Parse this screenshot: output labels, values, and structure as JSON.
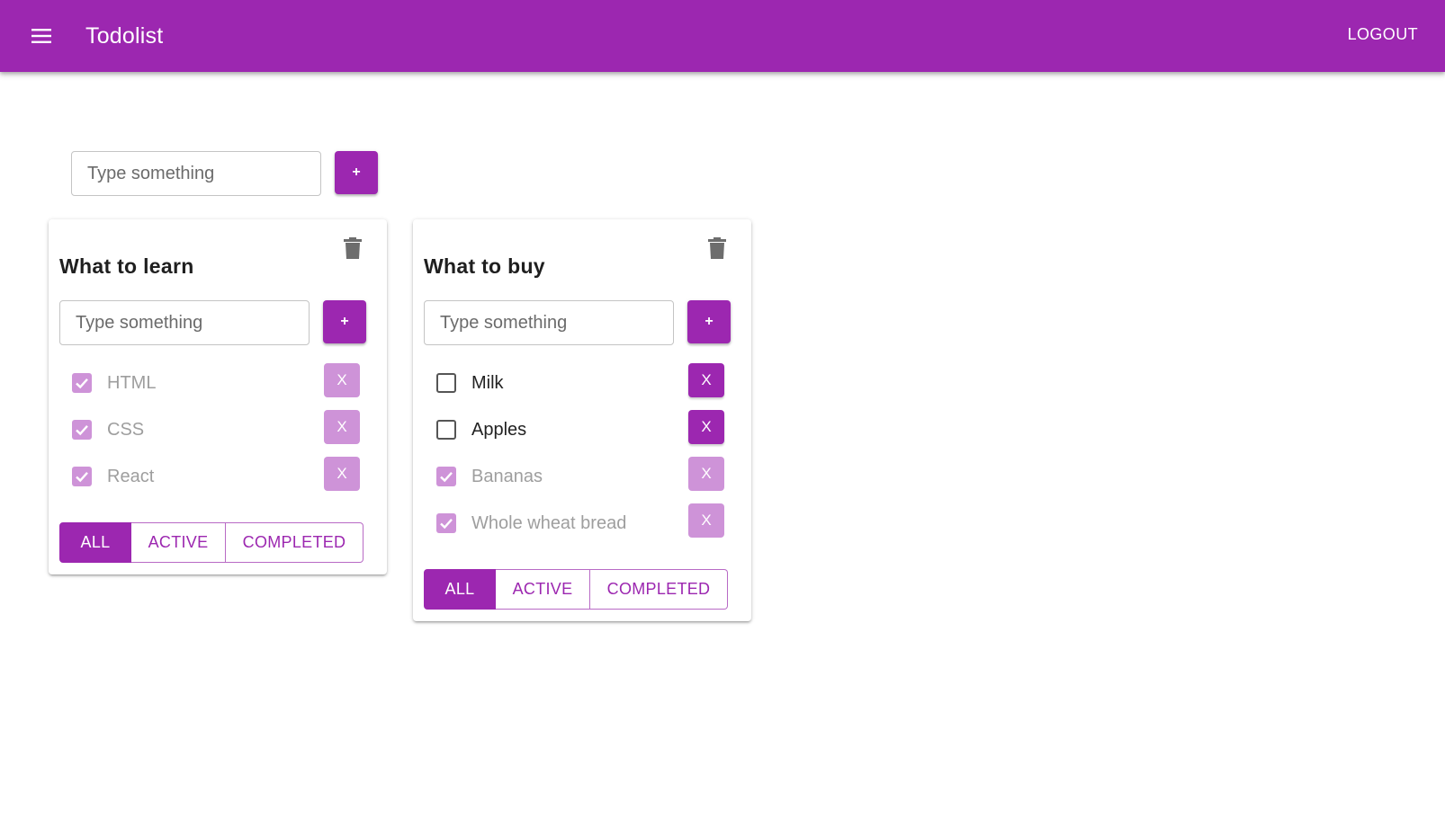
{
  "appbar": {
    "menu_icon": "menu-icon",
    "title": "Todolist",
    "logout_label": "LOGOUT",
    "color": "#9c27b0"
  },
  "new_list": {
    "placeholder": "Type something",
    "add_label": "+"
  },
  "lists": [
    {
      "title": "What to learn",
      "delete_icon": "trash-icon",
      "input_placeholder": "Type something",
      "add_label": "+",
      "tasks": [
        {
          "label": "HTML",
          "done": true,
          "remove_label": "X"
        },
        {
          "label": "CSS",
          "done": true,
          "remove_label": "X"
        },
        {
          "label": "React",
          "done": true,
          "remove_label": "X"
        }
      ],
      "filters": [
        "ALL",
        "ACTIVE",
        "COMPLETED"
      ],
      "selected_filter": "ALL"
    },
    {
      "title": "What to buy",
      "delete_icon": "trash-icon",
      "input_placeholder": "Type something",
      "add_label": "+",
      "tasks": [
        {
          "label": "Milk",
          "done": false,
          "remove_label": "X"
        },
        {
          "label": "Apples",
          "done": false,
          "remove_label": "X"
        },
        {
          "label": "Bananas",
          "done": true,
          "remove_label": "X"
        },
        {
          "label": "Whole wheat bread",
          "done": true,
          "remove_label": "X"
        }
      ],
      "filters": [
        "ALL",
        "ACTIVE",
        "COMPLETED"
      ],
      "selected_filter": "ALL"
    }
  ]
}
